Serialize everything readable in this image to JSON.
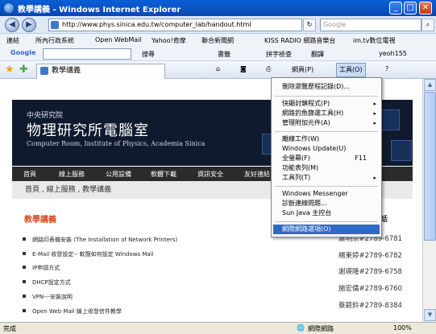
{
  "window": {
    "title": "教學講義 - Windows Internet Explorer",
    "minimize": "_",
    "maximize": "□",
    "close": "✕"
  },
  "address": {
    "url": "http://www.phys.sinica.edu.tw/computer_lab/handout.html",
    "search_placeholder": "Google"
  },
  "links_bar": {
    "label": "連結",
    "items": [
      "所內行政系統",
      "Open WebMail",
      "Yahoo!奇摩",
      "聯合新聞網",
      "KISS RADIO 網路音樂台",
      "im.tv數位電視"
    ]
  },
  "google_bar": {
    "logo": "Google",
    "search_btn": "搜尋",
    "bookmarks": "書籤",
    "spell": "拼字檢查",
    "translate": "翻譯",
    "account": "yeoh155"
  },
  "tab": {
    "label": "教學講義"
  },
  "command": {
    "page": "網頁(P)",
    "tools": "工具(O)"
  },
  "site": {
    "org": "中央研究院",
    "name": "物理研究所電腦室",
    "english": "Computer Room, Institute of Physics, Academia Sinica",
    "nav": [
      "首頁",
      "線上服務",
      "公用設備",
      "軟體下載",
      "資訊安全",
      "友好連結"
    ],
    "breadcrumb": "首頁 , 線上服務 , 教學講義",
    "section_title": "教學講義",
    "items": [
      "網路印表機安裝 (The Installation of Network Printers)",
      "E-Mail 收發設定-- 軟憩如何設定 Windows Mail",
      "IP申請方式",
      "DHCP設定方式",
      "VPN---安裝說明",
      "Open Web Mail 線上收發信件教學"
    ],
    "sidebar_header": "電話",
    "contacts": [
      {
        "name": "蕭明宗",
        "ext": "#2789-6781"
      },
      {
        "name": "楊東婷",
        "ext": "#2789-6782"
      },
      {
        "name": "謝瑛隆",
        "ext": "#2789-6758"
      },
      {
        "name": "施宏儒",
        "ext": "#2789-6760"
      },
      {
        "name": "蔡碧鈴",
        "ext": "#2789-8384"
      }
    ]
  },
  "menu": {
    "items": [
      {
        "label": "刪除瀏覽歷程記錄(D)...",
        "arrow": ""
      },
      {
        "label": "快顯封鎖程式(P)",
        "arrow": "▸"
      },
      {
        "label": "網路釣魚篩選工具(H)",
        "arrow": "▸"
      },
      {
        "label": "管理附加元件(A)",
        "arrow": "▸"
      },
      {
        "label": "離線工作(W)",
        "arrow": ""
      },
      {
        "label": "Windows Update(U)",
        "arrow": ""
      },
      {
        "label": "全螢幕(F)",
        "shortcut": "F11",
        "arrow": ""
      },
      {
        "label": "功能表列(M)",
        "arrow": ""
      },
      {
        "label": "工具列(T)",
        "arrow": "▸"
      },
      {
        "label": "Windows Messenger",
        "arrow": ""
      },
      {
        "label": "診斷連線問題...",
        "arrow": ""
      },
      {
        "label": "Sun Java 主控台",
        "arrow": ""
      },
      {
        "label": "網際網路選項(O)",
        "arrow": ""
      }
    ]
  },
  "status": {
    "left": "完成",
    "zone": "網際網路",
    "zoom": "100%"
  }
}
